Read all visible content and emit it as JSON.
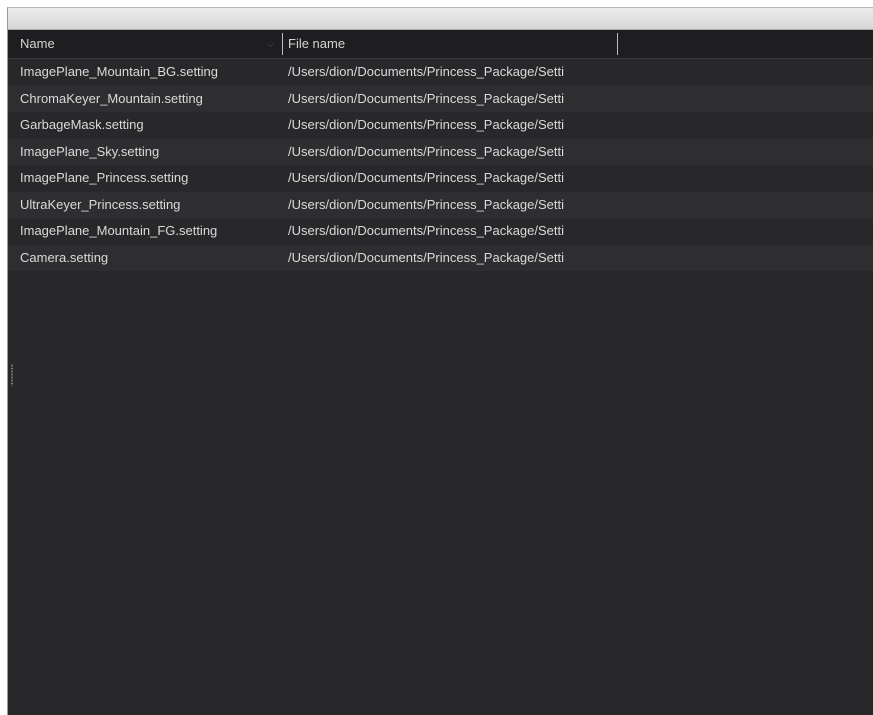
{
  "table": {
    "columns": {
      "name": "Name",
      "file_name": "File name"
    },
    "rows": [
      {
        "name": "ImagePlane_Mountain_BG.setting",
        "file": "/Users/dion/Documents/Princess_Package/Setti"
      },
      {
        "name": "ChromaKeyer_Mountain.setting",
        "file": "/Users/dion/Documents/Princess_Package/Setti"
      },
      {
        "name": "GarbageMask.setting",
        "file": "/Users/dion/Documents/Princess_Package/Setti"
      },
      {
        "name": "ImagePlane_Sky.setting",
        "file": "/Users/dion/Documents/Princess_Package/Setti"
      },
      {
        "name": "ImagePlane_Princess.setting",
        "file": "/Users/dion/Documents/Princess_Package/Setti"
      },
      {
        "name": "UltraKeyer_Princess.setting",
        "file": "/Users/dion/Documents/Princess_Package/Setti"
      },
      {
        "name": "ImagePlane_Mountain_FG.setting",
        "file": "/Users/dion/Documents/Princess_Package/Setti"
      },
      {
        "name": "Camera.setting",
        "file": "/Users/dion/Documents/Princess_Package/Setti"
      }
    ]
  },
  "icons": {
    "sort": "chevron-down-icon",
    "grip": "resize-grip-icon"
  },
  "colors": {
    "panel_background": "#28282b",
    "header_background": "#1e1e20",
    "alternate_row": "#2e2e31",
    "text": "#dadada"
  }
}
